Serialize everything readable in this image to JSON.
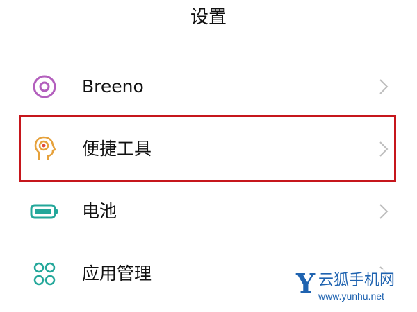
{
  "header": {
    "title": "设置"
  },
  "items": [
    {
      "label": "Breeno",
      "icon": "breeno-icon",
      "color": "#b35fbd"
    },
    {
      "label": "便捷工具",
      "icon": "head-gear-icon",
      "color": "#e6a13b"
    },
    {
      "label": "电池",
      "icon": "battery-icon",
      "color": "#23a79a"
    },
    {
      "label": "应用管理",
      "icon": "app-grid-icon",
      "color": "#23a79a"
    }
  ],
  "highlight_color": "#c6161c",
  "watermark": {
    "letter": "Y",
    "name": "云狐手机网",
    "url": "www.yunhu.net"
  }
}
